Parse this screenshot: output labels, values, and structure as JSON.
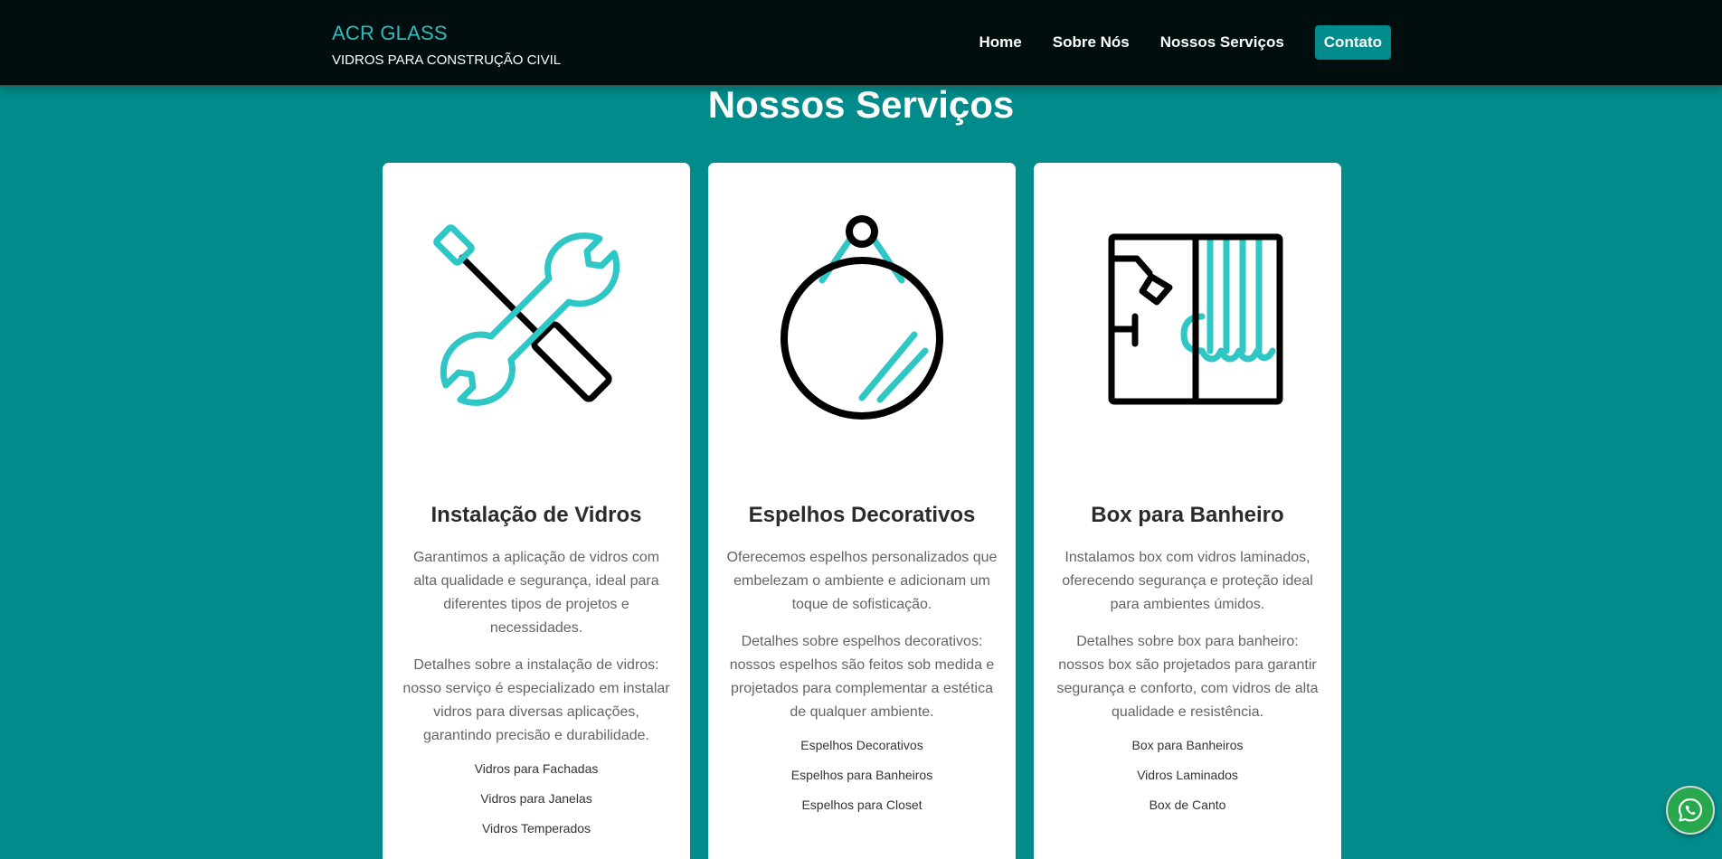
{
  "header": {
    "brand": "ACR GLASS",
    "tagline": "VIDROS PARA CONSTRUÇÃO CIVIL",
    "nav": [
      "Home",
      "Sobre Nós",
      "Nossos Serviços",
      "Contato"
    ]
  },
  "section": {
    "title": "Nossos Serviços"
  },
  "cards": [
    {
      "icon": "tools-icon",
      "title": "Instalação de Vidros",
      "p1": "Garantimos a aplicação de vidros com alta qualidade e segurança, ideal para diferentes tipos de projetos e necessidades.",
      "p2": "Detalhes sobre a instalação de vidros: nosso serviço é especializado em instalar vidros para diversas aplicações, garantindo precisão e durabilidade.",
      "items": [
        "Vidros para Fachadas",
        "Vidros para Janelas",
        "Vidros Temperados"
      ]
    },
    {
      "icon": "mirror-icon",
      "title": "Espelhos Decorativos",
      "p1": "Oferecemos espelhos personalizados que embelezam o ambiente e adicionam um toque de sofisticação.",
      "p2": "Detalhes sobre espelhos decorativos: nossos espelhos são feitos sob medida e projetados para complementar a estética de qualquer ambiente.",
      "items": [
        "Espelhos Decorativos",
        "Espelhos para Banheiros",
        "Espelhos para Closet"
      ]
    },
    {
      "icon": "shower-box-icon",
      "title": "Box para Banheiro",
      "p1": "Instalamos box com vidros laminados, oferecendo segurança e proteção ideal para ambientes úmidos.",
      "p2": "Detalhes sobre box para banheiro: nossos box são projetados para garantir segurança e conforto, com vidros de alta qualidade e resistência.",
      "items": [
        "Box para Banheiros",
        "Vidros Laminados",
        "Box de Canto"
      ]
    }
  ],
  "floating": {
    "icon": "whatsapp-icon"
  },
  "colors": {
    "background": "#018b8a",
    "header": "#020e0e",
    "accent": "#2fc6c6",
    "brand": "#2fbcbc"
  }
}
